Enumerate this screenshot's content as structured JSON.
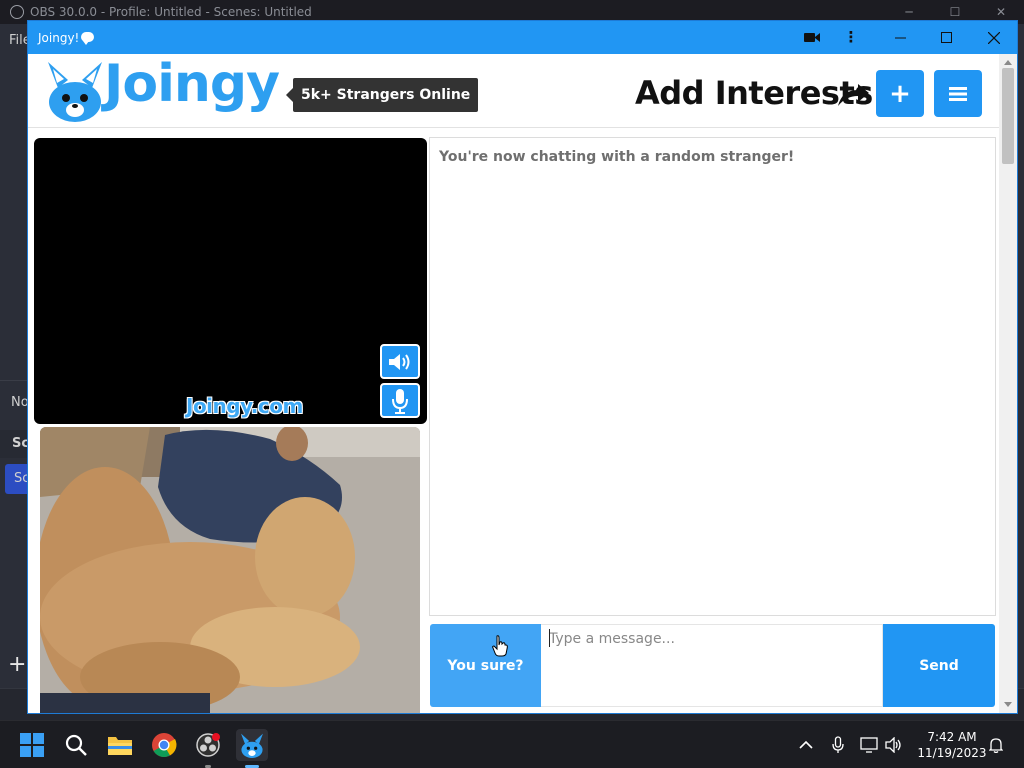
{
  "obs": {
    "title": "OBS 30.0.0 - Profile: Untitled - Scenes: Untitled",
    "menu_file": "File",
    "panel_no": "No",
    "panel_sc": "Sc",
    "scene_item": "Sc",
    "plus": "+"
  },
  "window": {
    "title": "Joingy!"
  },
  "header": {
    "logo_text": "Joingy",
    "strangers_online": "5k+ Strangers Online",
    "add_interests": "Add Interests",
    "add_button": "+",
    "menu_button": "≡"
  },
  "video": {
    "watermark": "Joingy.com"
  },
  "chat": {
    "system_message": "You're now chatting with a random stranger!",
    "stop_button": "You sure?",
    "input_placeholder": "Type a message...",
    "send_button": "Send"
  },
  "taskbar": {
    "time": "7:42 AM",
    "date": "11/19/2023"
  },
  "colors": {
    "brand_blue": "#2196f3",
    "logo_blue": "#2e9ff0"
  }
}
